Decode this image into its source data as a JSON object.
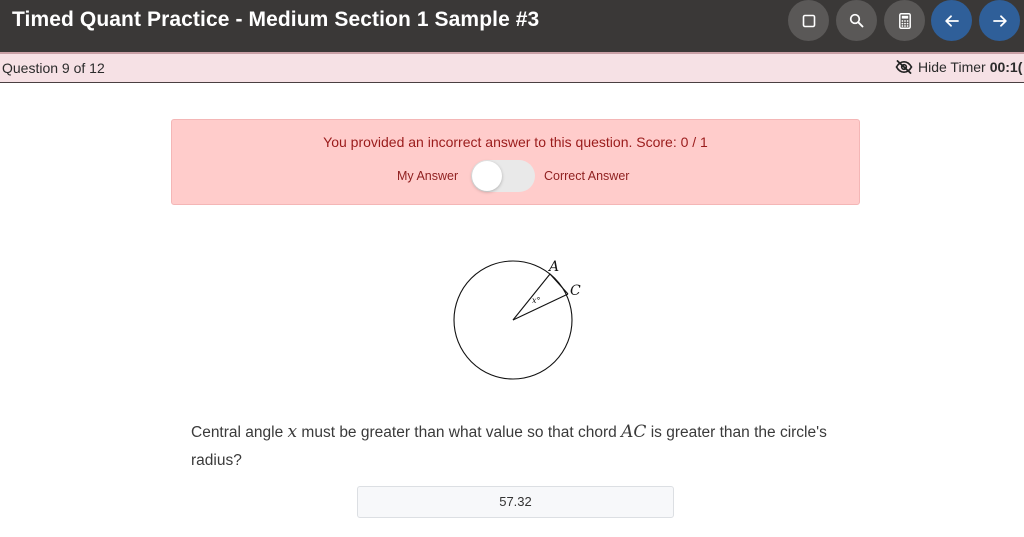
{
  "header": {
    "title": "Timed Quant Practice - Medium Section 1 Sample #3",
    "buttons": [
      {
        "icon": "square-icon",
        "label": "Mark"
      },
      {
        "icon": "search-icon",
        "label": "Review"
      },
      {
        "icon": "calculator-icon",
        "label": "Calculator"
      },
      {
        "icon": "arrow-left-icon",
        "label": "Back"
      },
      {
        "icon": "arrow-right-icon",
        "label": "Next"
      }
    ]
  },
  "status_bar": {
    "question_counter": "Question 9 of 12",
    "hide_timer_label": "Hide Timer",
    "timer_value": "00:1("
  },
  "result": {
    "message": "You provided an incorrect answer to this question. Score: 0 / 1",
    "my_answer_label": "My Answer",
    "correct_answer_label": "Correct Answer",
    "toggle_state": "my-answer"
  },
  "figure": {
    "point_a": "A",
    "point_c": "C",
    "angle_label": "x°"
  },
  "question": {
    "part1": "Central angle",
    "var_x": "x",
    "part2": "must be greater than what value so that chord",
    "chord": "AC",
    "part3": "is greater than the circle's radius?"
  },
  "answer": {
    "value": "57.32"
  },
  "colors": {
    "topbar_bg": "#3a3837",
    "subbar_bg": "#f6e1e5",
    "alert_bg": "#ffcccb",
    "alert_text": "#9a1b1b",
    "nav_blue": "#2f5f99"
  }
}
